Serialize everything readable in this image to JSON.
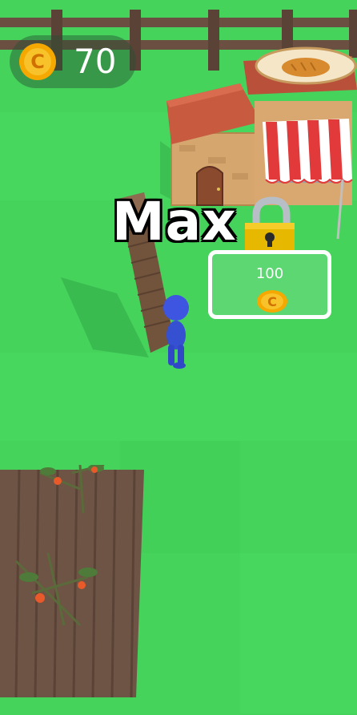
{
  "hud": {
    "coins": {
      "icon": "coin-icon",
      "value": "70"
    }
  },
  "player": {
    "name": "Max"
  },
  "unlock_pad": {
    "price": "100",
    "icon": "coin-icon",
    "lock_icon": "padlock-icon"
  },
  "scene": {
    "shop": {
      "sign_icon": "bread-icon"
    },
    "objects": [
      "wooden-fence",
      "bakery-shop",
      "wooden-plank-stack",
      "blue-character",
      "tomato-field"
    ]
  },
  "colors": {
    "grass": "#45d35c",
    "grass_light": "#4bdc63",
    "coin": "#f5a800",
    "lock": "#e6b800",
    "character": "#3d55e0",
    "soil": "#6e5444"
  }
}
